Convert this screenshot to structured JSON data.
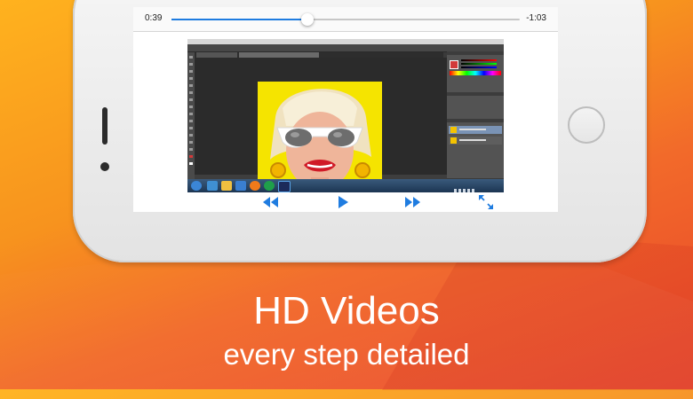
{
  "player": {
    "elapsed": "0:39",
    "remaining": "-1:03",
    "progress_fraction": 0.39,
    "accent_color": "#1f7ce0"
  },
  "controls": {
    "rewind_icon": "rewind-icon",
    "play_icon": "play-icon",
    "forward_icon": "fast-forward-icon",
    "fullscreen_icon": "expand-icon",
    "icon_color": "#1f7ce0"
  },
  "promo": {
    "headline": "HD Videos",
    "subline": "every step detailed"
  },
  "colors": {
    "background_top": "#ffb21e",
    "background_bottom": "#e8452b"
  }
}
